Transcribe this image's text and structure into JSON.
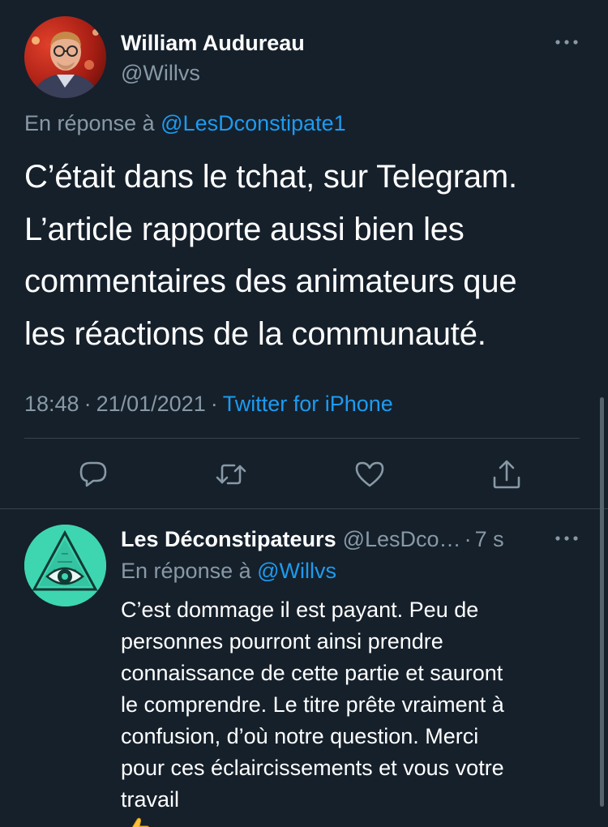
{
  "tweet": {
    "author_name": "William Audureau",
    "author_handle": "@Willvs",
    "reply_prefix": "En réponse à",
    "reply_handle": "@LesDconstipate1",
    "text_lines": [
      "C’était dans le tchat, sur Telegram.",
      "L’article rapporte aussi bien les",
      "commentaires des animateurs que",
      "les réactions de la communauté."
    ],
    "time": "18:48",
    "date": "21/01/2021",
    "separator": "·",
    "source": "Twitter for iPhone"
  },
  "actions": {
    "reply_icon": "reply-icon",
    "retweet_icon": "retweet-icon",
    "like_icon": "heart-icon",
    "share_icon": "share-icon"
  },
  "reply": {
    "author_name": "Les Déconstipateurs",
    "author_handle": "@LesDco…",
    "separator": "·",
    "time": "7 s",
    "reply_prefix": "En réponse à",
    "reply_handle": "@Willvs",
    "text_lines": [
      "C’est dommage il est payant. Peu de",
      "personnes pourront ainsi prendre",
      "connaissance de cette partie et sauront",
      "le comprendre. Le titre prête vraiment à",
      "confusion, d’où notre question. Merci",
      "pour ces éclaircissements et vous votre",
      "travail"
    ],
    "emoji": "thumbs-up-icon"
  },
  "colors": {
    "background": "#15202b",
    "text": "#ffffff",
    "secondary": "#8899a6",
    "link": "#1d9bf0",
    "divider": "#38444d",
    "reply_avatar": "#3dd6b0"
  }
}
